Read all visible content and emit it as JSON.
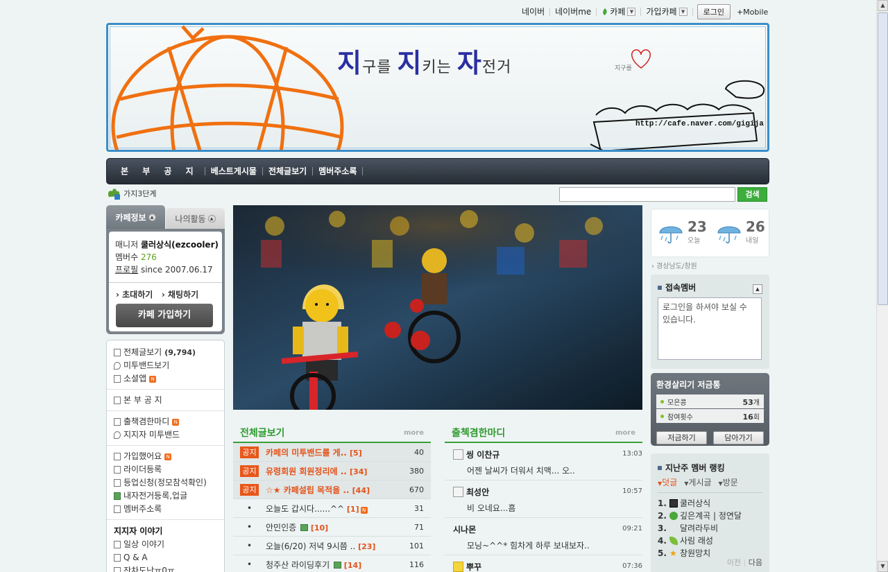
{
  "gnb": {
    "items": [
      "네이버",
      "네이버me",
      "카페",
      "가입카페"
    ],
    "login": "로그인",
    "mobile": "+Mobile"
  },
  "banner": {
    "title_parts": [
      "지",
      "구를 ",
      "지",
      "키는 ",
      "자",
      "전거"
    ],
    "signature": "지구를",
    "url": "http://cafe.naver.com/gigija"
  },
  "menu": [
    "본 부 공 지",
    "베스트게시물",
    "전체글보기",
    "멤버주소록"
  ],
  "level": "가지3단계",
  "search": {
    "placeholder": "",
    "button": "검색"
  },
  "cafe_info": {
    "tab_info": "카페정보",
    "tab_activity": "나의활동",
    "manager_label": "매니저",
    "manager": "쿨러상식(ezcooler)",
    "members_label": "멤버수",
    "members": "276",
    "profile_label": "프로필",
    "since": "since 2007.06.17",
    "invite": "초대하기",
    "chat": "채팅하기",
    "join": "카페 가입하기"
  },
  "left_menu": {
    "g1": {
      "all": "전체글보기",
      "all_count": "(9,794)",
      "band": "미투밴드보기",
      "social": "소셜앱"
    },
    "g2": {
      "notice": "본 부 공 지"
    },
    "g3": {
      "attend": "출책겸한마디",
      "band": "지지자 미투밴드"
    },
    "g4": {
      "joined": "가입했어요",
      "rider": "라이더등록",
      "levelup": "등업신청(정모참석확인)",
      "bike": "내자전거등록,업글",
      "address": "멤버주소록"
    },
    "g5": {
      "head": "지지자 이야기",
      "daily": "일상 이야기",
      "qa": "Q & A",
      "chatter": "잔차도난ㅠ0ㅠ"
    }
  },
  "board_all": {
    "title": "전체글보기",
    "more": "more",
    "rows": [
      {
        "tag": "공지",
        "title": "카페의 미투밴드를 게..",
        "comments": "[5]",
        "views": "40"
      },
      {
        "tag": "공지",
        "title": "유령회원 회원정리에 ..",
        "comments": "[34]",
        "views": "380"
      },
      {
        "tag": "공지",
        "title": "☆★ 카페설립 목적을 ..",
        "comments": "[44]",
        "views": "670"
      },
      {
        "bullet": "•",
        "title": "오늘도 갑시다......^^",
        "comments": "[1]",
        "views": "31"
      },
      {
        "bullet": "•",
        "title": "안민인증",
        "comments": "[10]",
        "views": "71"
      },
      {
        "bullet": "•",
        "title": "오늘(6/20) 저녁 9시쯤 ..",
        "comments": "[23]",
        "views": "101"
      },
      {
        "bullet": "•",
        "title": "청주산 라이딩후기",
        "comments": "[14]",
        "views": "116"
      }
    ]
  },
  "board_comment": {
    "title": "출첵겸한마디",
    "more": "more",
    "rows": [
      {
        "name": "씽 이찬규",
        "time": "13:03",
        "msg": "어젠 날씨가 더워서 치맥...  오.."
      },
      {
        "name": "최성안",
        "time": "10:57",
        "msg": "비 오네요...흠"
      },
      {
        "name": "시나몬",
        "time": "09:21",
        "msg": "모닝~^^* 힘차게 하루 보내보자.."
      },
      {
        "name": "뿌꾸",
        "time": "07:36",
        "msg": ""
      }
    ]
  },
  "weather": {
    "today_temp": "23",
    "today_label": "오늘",
    "tomorrow_temp": "26",
    "tomorrow_label": "내일",
    "region": "› 경상남도/창원"
  },
  "connected": {
    "title": "접속멤버",
    "message": "로그인을 하셔야 보실 수 있습니다."
  },
  "eco": {
    "title": "환경살리기 저금통",
    "stat1_label": "모은콩",
    "stat1_value": "53",
    "stat1_unit": "개",
    "stat2_label": "참여횟수",
    "stat2_value": "16",
    "stat2_unit": "회",
    "save_btn": "저금하기",
    "look_btn": "담아가기"
  },
  "ranking": {
    "title": "지난주 멤버 랭킹",
    "tabs": [
      "덧글",
      "게시글",
      "방문"
    ],
    "items": [
      {
        "n": "1.",
        "name": "쿨러상식"
      },
      {
        "n": "2.",
        "name": "깊은계곡  |  정연달"
      },
      {
        "n": "3.",
        "name": "달려라두비"
      },
      {
        "n": "4.",
        "name": "사림 래성"
      },
      {
        "n": "5.",
        "name": "창원망치"
      }
    ],
    "prev": "이전",
    "next": "다음"
  },
  "colors": {
    "accent_green": "#37a037",
    "notice_orange": "#e8571a",
    "banner_blue": "#3a8ec8"
  }
}
